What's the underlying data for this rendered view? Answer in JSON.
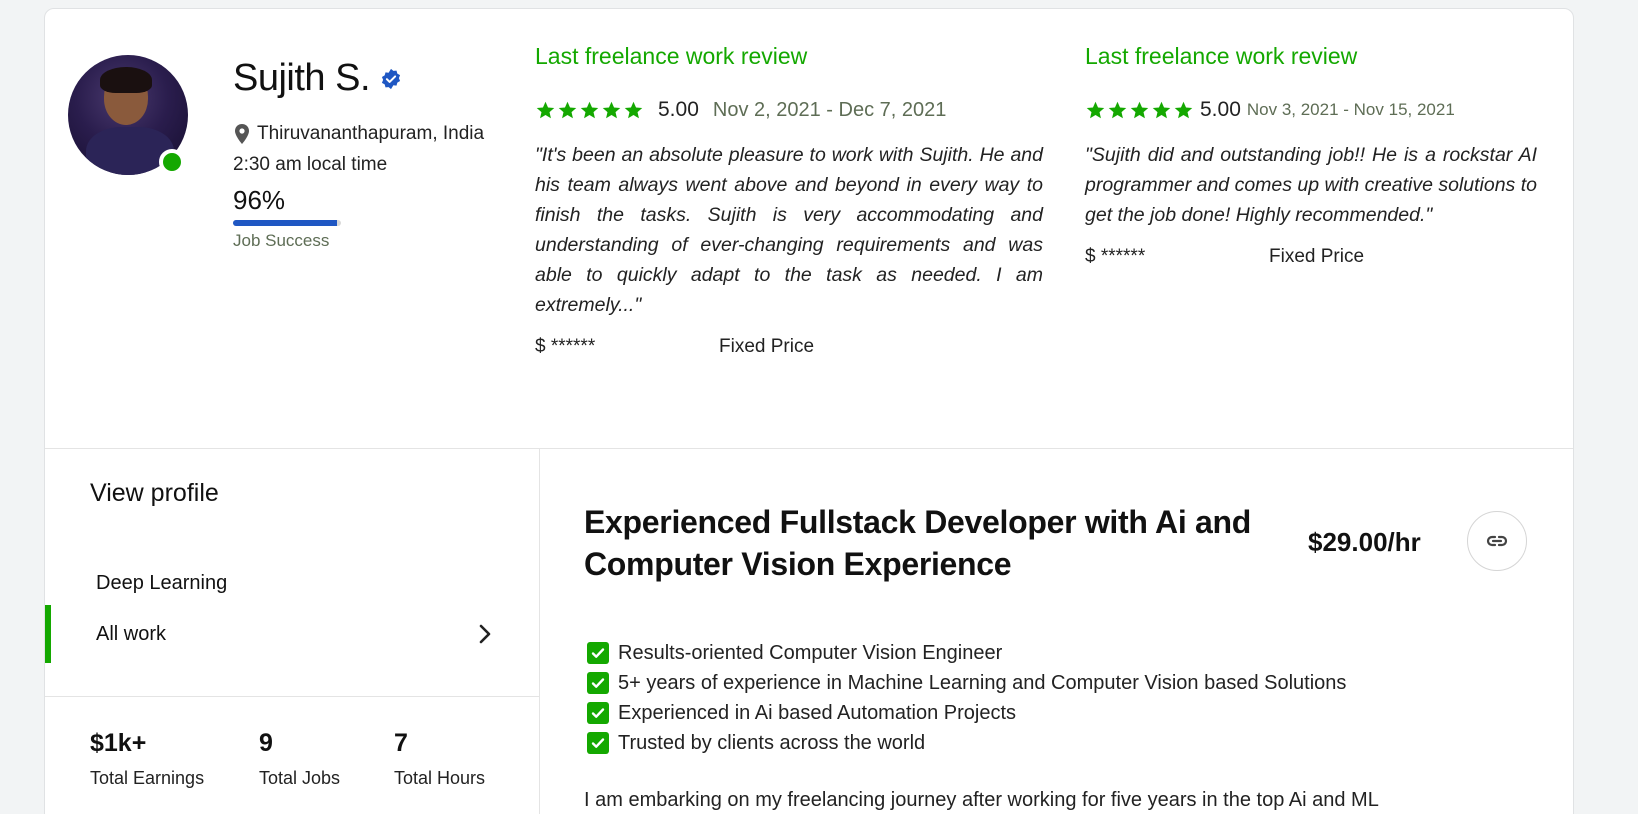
{
  "profile": {
    "name": "Sujith S.",
    "location": "Thiruvananthapuram, India",
    "local_time": "2:30 am local time",
    "job_success_pct": "96%",
    "job_success_fraction": 0.96,
    "job_success_label": "Job Success"
  },
  "reviews": [
    {
      "title": "Last freelance work review",
      "rating": "5.00",
      "stars": 5,
      "dates": "Nov 2, 2021 - Dec 7, 2021",
      "quote": "\"It's been an absolute pleasure to work with Sujith. He and his team always went above and beyond in every way to finish the tasks. Sujith is very accommodating and understanding of ever-changing requirements and was able to quickly adapt to the task as needed. I am extremely...\"",
      "amount": "$ ******",
      "type": "Fixed Price"
    },
    {
      "title": "Last freelance work review",
      "rating": "5.00",
      "stars": 5,
      "dates": "Nov 3, 2021 - Nov 15, 2021",
      "quote": "\"Sujith did and outstanding job!! He is a rockstar AI programmer and comes up with creative solutions to get the job done! Highly recommended.\"",
      "amount": "$ ******",
      "type": "Fixed Price"
    }
  ],
  "sidebar": {
    "heading": "View profile",
    "items": [
      {
        "label": "Deep Learning"
      },
      {
        "label": "All work"
      }
    ]
  },
  "stats": [
    {
      "value": "$1k+",
      "label": "Total Earnings"
    },
    {
      "value": "9",
      "label": "Total Jobs"
    },
    {
      "value": "7",
      "label": "Total Hours"
    }
  ],
  "main": {
    "headline": "Experienced Fullstack Developer with Ai and Computer Vision Experience",
    "rate": "$29.00/hr",
    "bullets": [
      "Results-oriented Computer Vision Engineer",
      "5+ years of experience in Machine Learning and Computer Vision based Solutions",
      "Experienced in Ai based Automation Projects",
      "Trusted by clients across the world"
    ],
    "intro": "I am embarking on my freelancing journey after working for five years in the top Ai and ML"
  },
  "colors": {
    "brand_green": "#14a800",
    "jss_blue": "#1f57c3",
    "verified_blue": "#1f57c3"
  },
  "icons": [
    "verified-badge-icon",
    "location-pin-icon",
    "star-icon",
    "chevron-right-icon",
    "link-icon",
    "checkbox-checked-icon"
  ]
}
